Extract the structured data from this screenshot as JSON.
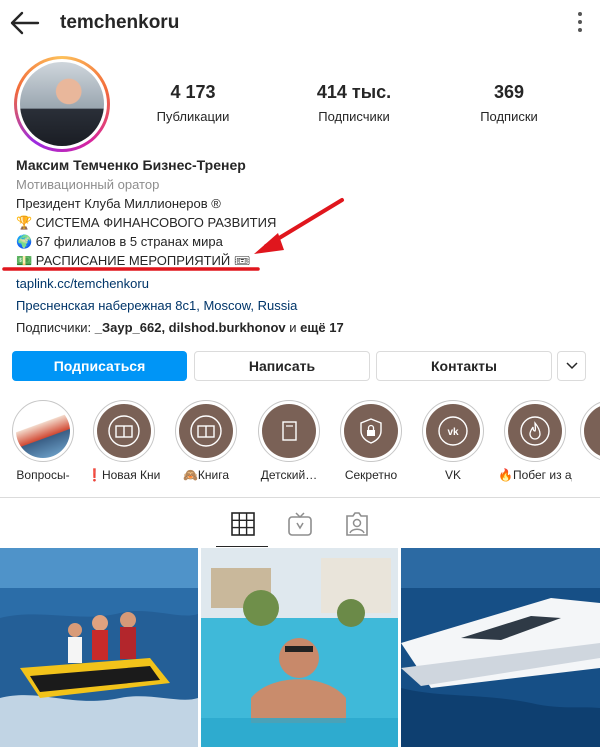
{
  "header": {
    "username": "temchenkoru"
  },
  "profile": {
    "stats": [
      {
        "value": "4 173",
        "label": "Публикации"
      },
      {
        "value": "414 тыс.",
        "label": "Подписчики"
      },
      {
        "value": "369",
        "label": "Подписки"
      }
    ]
  },
  "bio": {
    "name": "Максим Темченко Бизнес-Тренер",
    "category": "Мотивационный оратор",
    "line1": "Президент Клуба Миллионеров ®",
    "line2": "🏆 СИСТЕМА ФИНАНСОВОГО РАЗВИТИЯ",
    "line3": "🌍 67 филиалов в 5 странах мира",
    "line4": "💵 РАСПИСАНИЕ МЕРОПРИЯТИЙ 🎟",
    "link": "taplink.cc/temchenkoru",
    "address": "Пресненская набережная 8с1, Moscow, Russia",
    "followers_prefix": "Подписчики: ",
    "followers_names": "_Зауp_662, dilshod.burkhonov",
    "followers_and": " и ",
    "followers_more": "ещё 17"
  },
  "actions": {
    "follow": "Подписаться",
    "message": "Написать",
    "contacts": "Контакты"
  },
  "highlights": [
    {
      "label": "Вопросы-",
      "icon": "photo"
    },
    {
      "label": "❗Новая Книга",
      "icon": "book-icon"
    },
    {
      "label": "🙈Книга",
      "icon": "book-icon"
    },
    {
      "label": "Детский…",
      "icon": "page-icon"
    },
    {
      "label": "Секретно",
      "icon": "shield-lock-icon"
    },
    {
      "label": "VK",
      "icon": "vk-icon"
    },
    {
      "label": "🔥Побег из ада",
      "icon": "flame-icon"
    }
  ],
  "colors": {
    "accent": "#0095f6",
    "annotation": "#e0161d",
    "highlight_bg": "#7a6156"
  }
}
